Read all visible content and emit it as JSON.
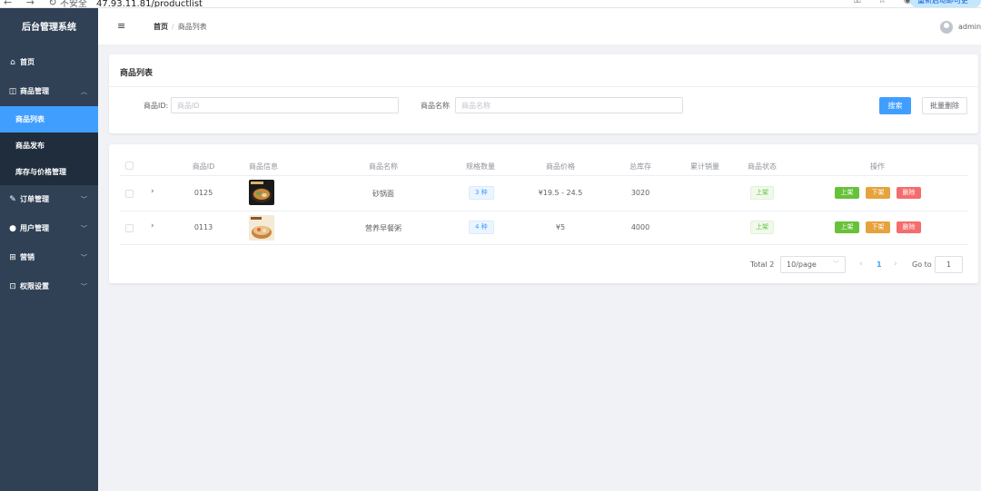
{
  "browser": {
    "nav_icons": "← → ↻",
    "security_label": "不安全",
    "url": "47.93.11.81/productlist",
    "right_icons": "⚿ ☆ ◉",
    "update_label": "重新启动即可更新 ⋮"
  },
  "sidebar": {
    "brand": "后台管理系统",
    "items": [
      {
        "label": "首页",
        "icon": "home-icon",
        "glyph": "⌂"
      },
      {
        "label": "商品管理",
        "icon": "shopping-bag-icon",
        "glyph": "◫",
        "arrow": "︿"
      },
      {
        "label": "订单管理",
        "icon": "order-icon",
        "glyph": "✎",
        "arrow": "﹀"
      },
      {
        "label": "用户管理",
        "icon": "user-icon",
        "glyph": "●",
        "arrow": "﹀"
      },
      {
        "label": "营销",
        "icon": "gift-icon",
        "glyph": "⊞",
        "arrow": "﹀"
      },
      {
        "label": "权限设置",
        "icon": "lock-icon",
        "glyph": "⊡",
        "arrow": "﹀"
      }
    ],
    "submenu": [
      {
        "label": "商品列表",
        "active": true
      },
      {
        "label": "商品发布"
      },
      {
        "label": "库存与价格管理"
      }
    ]
  },
  "header": {
    "hamburger": "≡",
    "breadcrumb_home": "首页",
    "breadcrumb_sep": "/",
    "breadcrumb_current": "商品列表",
    "username": "admin"
  },
  "filter": {
    "title": "商品列表",
    "id_label": "商品ID:",
    "id_placeholder": "商品ID",
    "name_label": "商品名称",
    "name_placeholder": "商品名称",
    "search_label": "搜索",
    "batch_delete_label": "批量删除"
  },
  "table": {
    "columns": [
      "商品ID",
      "商品信息",
      "商品名称",
      "规格数量",
      "商品价格",
      "总库存",
      "累计销量",
      "商品状态",
      "操作"
    ],
    "rows": [
      {
        "id": "0125",
        "name": "砂锅面",
        "spec": "3 种",
        "price": "¥19.5 - 24.5",
        "stock": "3020",
        "sales": "",
        "status": "上架"
      },
      {
        "id": "0113",
        "name": "营养早餐粥",
        "spec": "4 种",
        "price": "¥5",
        "stock": "4000",
        "sales": "",
        "status": "上架"
      }
    ],
    "actions": {
      "on": "上架",
      "off": "下架",
      "delete": "删除"
    },
    "expand_glyph": "›"
  },
  "pagination": {
    "total": "Total 2",
    "page_size": "10/page",
    "current_page": "1",
    "goto_label": "Go to",
    "goto_value": "1"
  }
}
